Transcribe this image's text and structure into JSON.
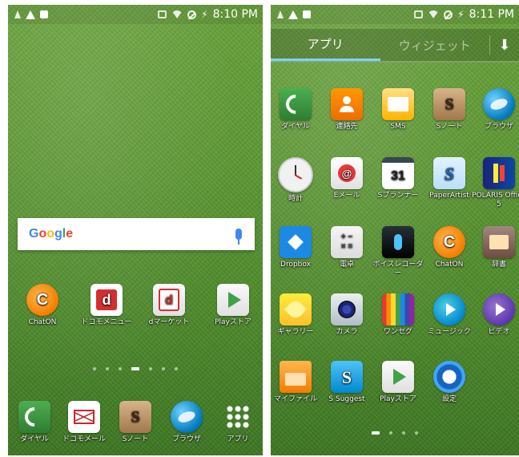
{
  "left_screen": {
    "status_bar": {
      "time": "8:10 PM"
    },
    "search_widget": {
      "logo": "Google"
    },
    "apps": [
      {
        "label": "ChatON",
        "icon": "chaton-icon"
      },
      {
        "label": "ドコモメニュー",
        "icon": "dmenu-icon"
      },
      {
        "label": "dマーケット",
        "icon": "dmarket-icon"
      },
      {
        "label": "Playストア",
        "icon": "playstore-icon"
      }
    ],
    "dock": [
      {
        "label": "ダイヤル",
        "icon": "phone-icon"
      },
      {
        "label": "ドコモメール",
        "icon": "docomo-mail-icon"
      },
      {
        "label": "Sノート",
        "icon": "snote-icon"
      },
      {
        "label": "ブラウザ",
        "icon": "browser-icon"
      },
      {
        "label": "アプリ",
        "icon": "apps-grid-icon"
      }
    ],
    "page_indicator": {
      "pages": 7,
      "current": 4
    }
  },
  "right_screen": {
    "status_bar": {
      "time": "8:11 PM"
    },
    "tabs": [
      {
        "label": "アプリ",
        "active": true
      },
      {
        "label": "ウィジェット",
        "active": false
      }
    ],
    "apps": [
      {
        "label": "ダイヤル",
        "icon": "phone-icon"
      },
      {
        "label": "連絡先",
        "icon": "contacts-icon"
      },
      {
        "label": "SMS",
        "icon": "sms-icon"
      },
      {
        "label": "Sノート",
        "icon": "snote-icon"
      },
      {
        "label": "ブラウザ",
        "icon": "browser-icon"
      },
      {
        "label": "時計",
        "icon": "clock-icon"
      },
      {
        "label": "Eメール",
        "icon": "email-icon"
      },
      {
        "label": "Sプランナー",
        "icon": "calendar-icon",
        "text": "31"
      },
      {
        "label": "PaperArtist",
        "icon": "paper-artist-icon"
      },
      {
        "label": "POLARIS Office 5",
        "icon": "polaris-icon"
      },
      {
        "label": "Dropbox",
        "icon": "dropbox-icon"
      },
      {
        "label": "電卓",
        "icon": "calculator-icon"
      },
      {
        "label": "ボイスレコーダー",
        "icon": "voice-recorder-icon"
      },
      {
        "label": "ChatON",
        "icon": "chaton-icon"
      },
      {
        "label": "辞書",
        "icon": "dictionary-icon"
      },
      {
        "label": "ギャラリー",
        "icon": "gallery-icon"
      },
      {
        "label": "カメラ",
        "icon": "camera-icon"
      },
      {
        "label": "ワンセグ",
        "icon": "oneseg-icon"
      },
      {
        "label": "ミュージック",
        "icon": "music-icon"
      },
      {
        "label": "ビデオ",
        "icon": "video-icon"
      },
      {
        "label": "マイファイル",
        "icon": "folder-icon"
      },
      {
        "label": "S Suggest",
        "icon": "s-suggest-icon"
      },
      {
        "label": "Playストア",
        "icon": "playstore-icon"
      },
      {
        "label": "設定",
        "icon": "settings-icon"
      }
    ],
    "page_indicator": {
      "pages": 4,
      "current": 1
    }
  },
  "colors": {
    "grass": "#5f9a35",
    "tab_underline": "#7fd3ff"
  }
}
